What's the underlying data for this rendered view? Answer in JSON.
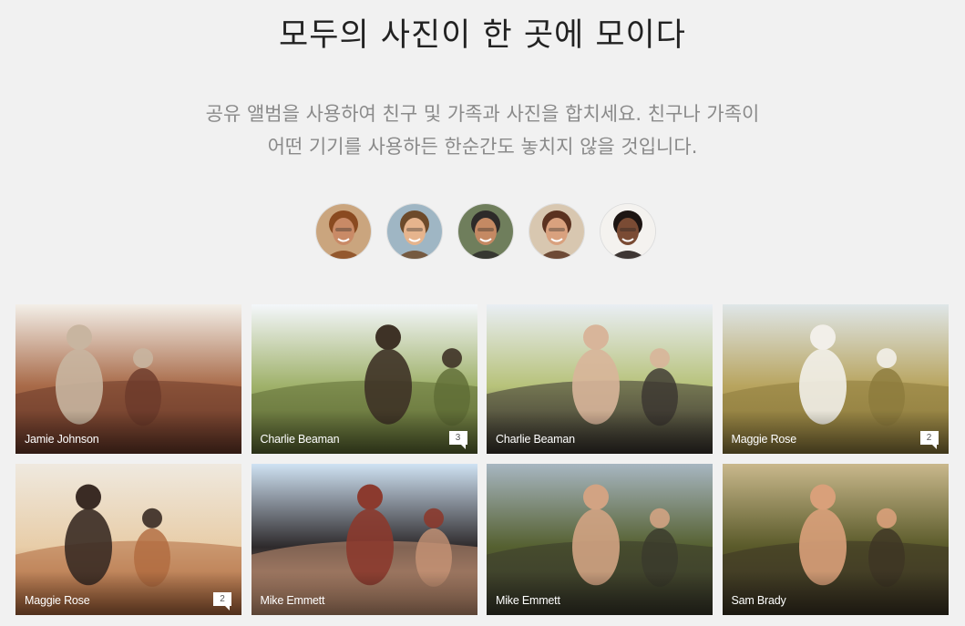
{
  "hero": {
    "title": "모두의 사진이 한 곳에 모이다",
    "description_line1": "공유 앨범을 사용하여 친구 및 가족과 사진을 합치세요. 친구나 가족이",
    "description_line2": "어떤 기기를 사용하든 한순간도 놓치지 않을 것입니다."
  },
  "avatars": [
    {
      "icon": "avatar-photo",
      "skin": "#c98a66",
      "hair": "#8a4a20",
      "bg": "#caa57e"
    },
    {
      "icon": "avatar-photo",
      "skin": "#e6b48d",
      "hair": "#6d4a2a",
      "bg": "#9fb6c4"
    },
    {
      "icon": "avatar-photo",
      "skin": "#c48963",
      "hair": "#2d2a29",
      "bg": "#6f7e5c"
    },
    {
      "icon": "avatar-photo",
      "skin": "#d9a17e",
      "hair": "#5b3220",
      "bg": "#d8c7b0"
    },
    {
      "icon": "avatar-photo",
      "skin": "#7a4b34",
      "hair": "#1d1513",
      "bg": "#f4f2ef"
    }
  ],
  "albums": [
    {
      "owner": "Jamie Johnson",
      "comments": "",
      "palette": [
        "#f3efe8",
        "#a86a48",
        "#6b3a2a",
        "#c8b5a0"
      ]
    },
    {
      "owner": "Charlie Beaman",
      "comments": "3",
      "palette": [
        "#f4f7fb",
        "#9fb16a",
        "#5e6b34",
        "#3e3226"
      ]
    },
    {
      "owner": "Charlie Beaman",
      "comments": "",
      "palette": [
        "#e9eef4",
        "#b7c27a",
        "#3a3530",
        "#d8b59a"
      ]
    },
    {
      "owner": "Maggie Rose",
      "comments": "2",
      "palette": [
        "#dfe6e8",
        "#b8a45e",
        "#8c7a3c",
        "#f2efe9"
      ]
    },
    {
      "owner": "Maggie Rose",
      "comments": "2",
      "palette": [
        "#efe9df",
        "#e8cda8",
        "#b06a3e",
        "#3a2b24"
      ]
    },
    {
      "owner": "Mike Emmett",
      "comments": "",
      "palette": [
        "#cfe2f3",
        "#2e2a2c",
        "#c79475",
        "#8b3a2e"
      ]
    },
    {
      "owner": "Mike Emmett",
      "comments": "",
      "palette": [
        "#a7b6c1",
        "#556030",
        "#3a3a2c",
        "#d2a383"
      ]
    },
    {
      "owner": "Sam Brady",
      "comments": "",
      "palette": [
        "#c9b88c",
        "#5a5a2a",
        "#3d3524",
        "#d9a07a"
      ]
    }
  ]
}
